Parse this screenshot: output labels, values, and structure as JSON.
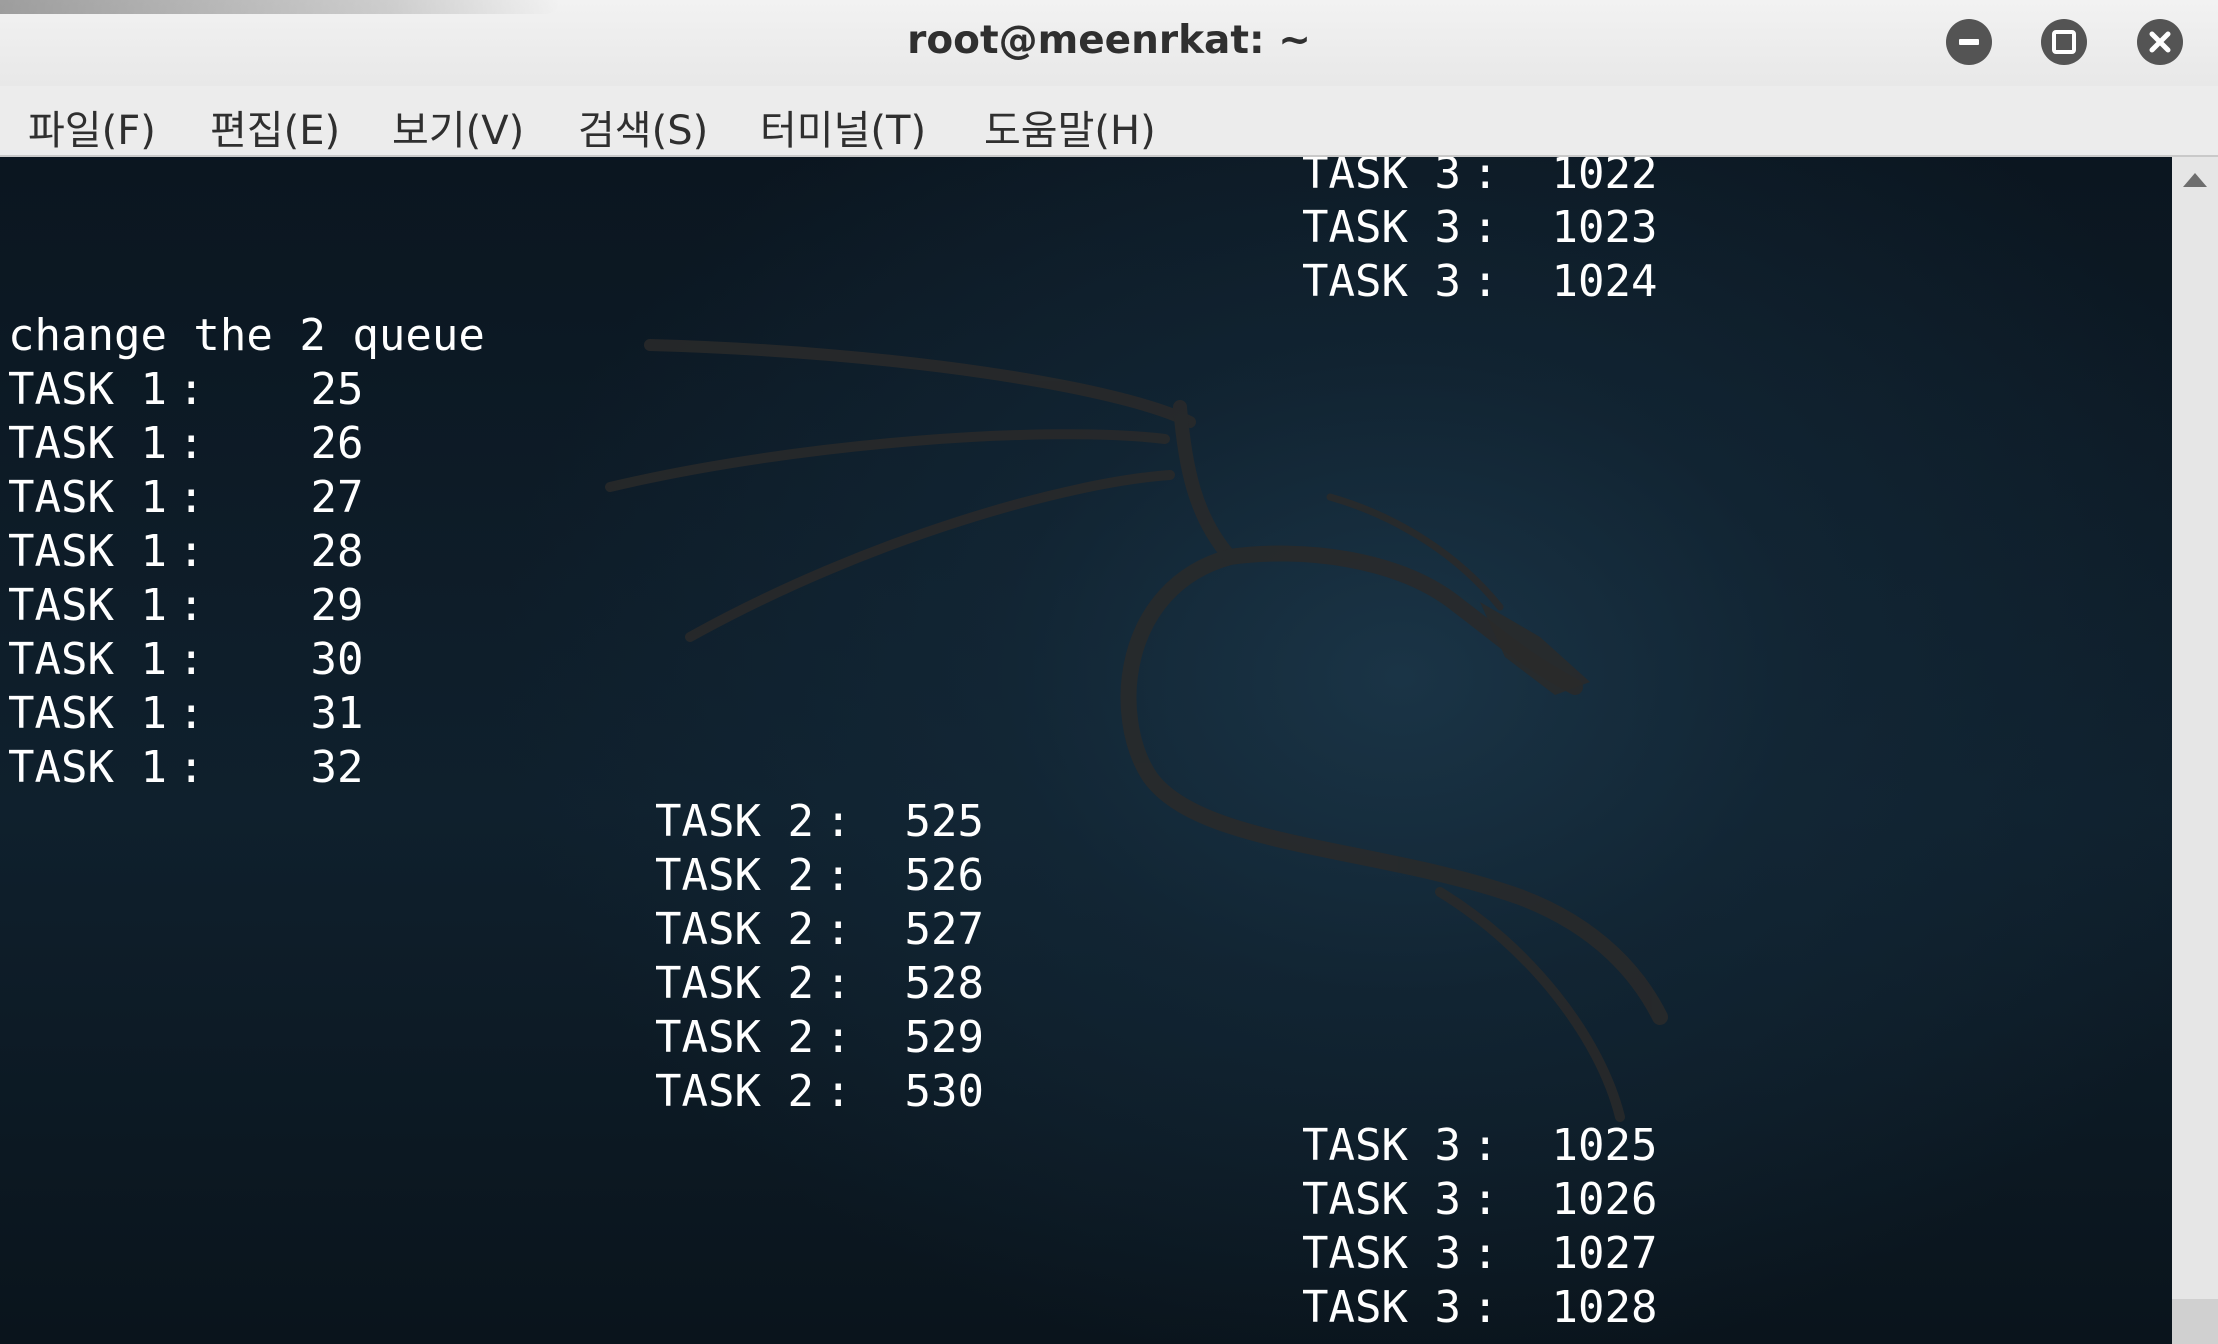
{
  "window": {
    "title": "root@meenrkat: ~"
  },
  "menu": [
    {
      "label": "파일(F)"
    },
    {
      "label": "편집(E)"
    },
    {
      "label": "보기(V)"
    },
    {
      "label": "검색(S)"
    },
    {
      "label": "터미널(T)"
    },
    {
      "label": "도움말(H)"
    }
  ],
  "terminal": {
    "top_task3": [
      {
        "task": "TASK 3",
        "sep": ":",
        "value": "1022"
      },
      {
        "task": "TASK 3",
        "sep": ":",
        "value": "1023"
      },
      {
        "task": "TASK 3",
        "sep": ":",
        "value": "1024"
      }
    ],
    "message": "change the 2 queue",
    "task1": [
      {
        "task": "TASK 1",
        "sep": ":",
        "value": "25"
      },
      {
        "task": "TASK 1",
        "sep": ":",
        "value": "26"
      },
      {
        "task": "TASK 1",
        "sep": ":",
        "value": "27"
      },
      {
        "task": "TASK 1",
        "sep": ":",
        "value": "28"
      },
      {
        "task": "TASK 1",
        "sep": ":",
        "value": "29"
      },
      {
        "task": "TASK 1",
        "sep": ":",
        "value": "30"
      },
      {
        "task": "TASK 1",
        "sep": ":",
        "value": "31"
      },
      {
        "task": "TASK 1",
        "sep": ":",
        "value": "32"
      }
    ],
    "task2": [
      {
        "task": "TASK 2",
        "sep": ":",
        "value": "525"
      },
      {
        "task": "TASK 2",
        "sep": ":",
        "value": "526"
      },
      {
        "task": "TASK 2",
        "sep": ":",
        "value": "527"
      },
      {
        "task": "TASK 2",
        "sep": ":",
        "value": "528"
      },
      {
        "task": "TASK 2",
        "sep": ":",
        "value": "529"
      },
      {
        "task": "TASK 2",
        "sep": ":",
        "value": "530"
      }
    ],
    "bottom_task3": [
      {
        "task": "TASK 3",
        "sep": ":",
        "value": "1025"
      },
      {
        "task": "TASK 3",
        "sep": ":",
        "value": "1026"
      },
      {
        "task": "TASK 3",
        "sep": ":",
        "value": "1027"
      },
      {
        "task": "TASK 3",
        "sep": ":",
        "value": "1028"
      }
    ]
  },
  "colors": {
    "terminal_text": "#ffffff",
    "terminal_bg": "#0e1821",
    "titlebar_bg": "#ececec",
    "window_button": "#545454"
  },
  "icons": [
    "minimize-icon",
    "maximize-icon",
    "close-icon",
    "dragon-logo-icon",
    "scroll-up-icon"
  ]
}
